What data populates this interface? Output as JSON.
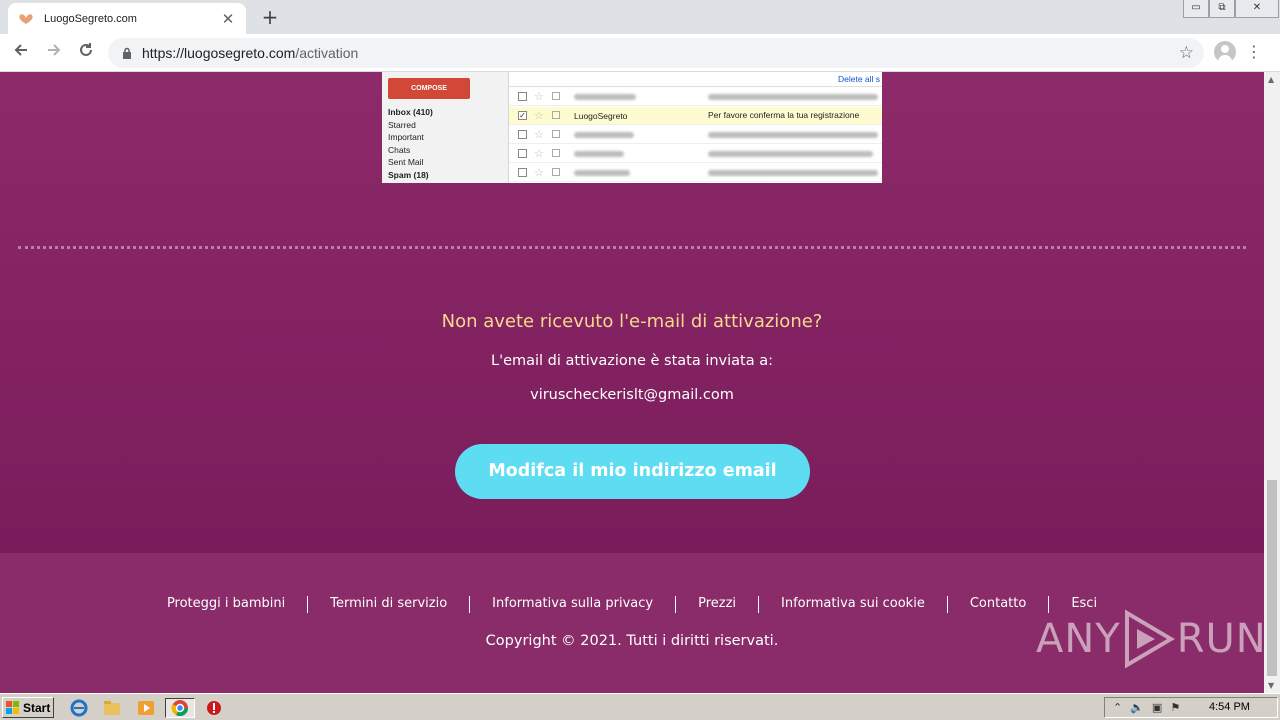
{
  "browser": {
    "tab_title": "LuogoSegreto.com",
    "tab_close": "✕",
    "new_tab": "+",
    "url_host": "https://luogosegreto.com",
    "url_path": "/activation",
    "window_controls": {
      "minimize": "▭",
      "restore": "⧉",
      "close": "✕"
    }
  },
  "mail_preview": {
    "compose_label": "COMPOSE",
    "folders": [
      "Inbox (410)",
      "Starred",
      "Important",
      "Chats",
      "Sent Mail",
      "Spam (18)"
    ],
    "delete_all": "Delete all s",
    "highlighted_from": "LuogoSegreto",
    "highlighted_subject": "Per favore conferma la tua registrazione"
  },
  "activation": {
    "question": "Non avete ricevuto l'e-mail di attivazione?",
    "sent_to_label": "L'email di attivazione è stata inviata a:",
    "email": "viruscheckerislt@gmail.com",
    "change_button": "Modifca il mio indirizzo email"
  },
  "footer": {
    "links": [
      "Proteggi i bambini",
      "Termini di servizio",
      "Informativa sulla privacy",
      "Prezzi",
      "Informativa sui cookie",
      "Contatto",
      "Esci"
    ],
    "copyright": "Copyright © 2021. Tutti i diritti riservati."
  },
  "watermark": {
    "left": "ANY",
    "right": "RUN"
  },
  "taskbar": {
    "start_label": "Start",
    "clock": "4:54 PM"
  },
  "colors": {
    "page_bg": "#8d2a6a",
    "heading_accent": "#f7d88c",
    "button_bg": "#5ddcf2"
  }
}
